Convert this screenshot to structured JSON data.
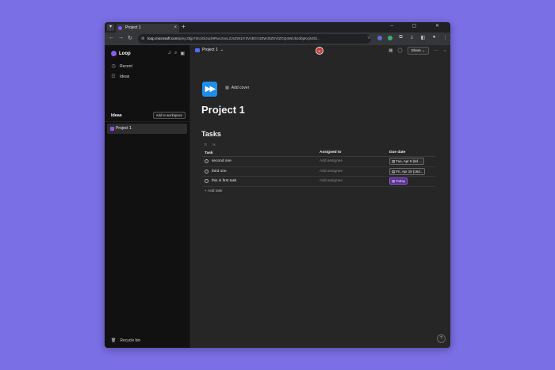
{
  "browser": {
    "tab_title": "Project 1",
    "url_host": "loop.microsoft.com",
    "url_path": "/p/eyJ3ljp7InUiOiJodHRwczovL2JsZW1iY3VnbGV3ZWJ0ZSVlZGQ4WU5zd0pKcjNGb...",
    "controls": "–  ▢  ✕"
  },
  "sidebar": {
    "brand": "Loop",
    "nav": [
      {
        "label": "Recent",
        "icon": "clock-icon"
      },
      {
        "label": "Ideas",
        "icon": "ideas-icon"
      }
    ],
    "section_title": "Ideas",
    "add_workspace": "Add to workspace",
    "project": "Project 1",
    "recycle": "Recycle bin"
  },
  "topbar": {
    "crumb": "Project 1",
    "avatar_initials": "H",
    "share": "Share"
  },
  "page": {
    "add_cover": "Add cover",
    "title": "Project 1",
    "tasks_heading": "Tasks",
    "tool_1": "Tt",
    "tool_2": "%",
    "columns": {
      "task": "Task",
      "assigned": "Assigned to",
      "due": "Due date"
    },
    "rows": [
      {
        "task": "second one",
        "assignee": "Add assignee",
        "due": "Tue, Apr 9 (6d ...",
        "today": false
      },
      {
        "task": "third one",
        "assignee": "Add assignee",
        "due": "Fri, Apr 19 (16d...",
        "today": false
      },
      {
        "task": "this is first task",
        "assignee": "Add assignee",
        "due": "Today",
        "today": true
      }
    ],
    "add_task": "Add task"
  },
  "colors": {
    "background": "#7b6fe6",
    "sidebar": "#111111",
    "main": "#262626",
    "today_chip": "#5a2f92",
    "page_icon": "#1f8ee8"
  }
}
